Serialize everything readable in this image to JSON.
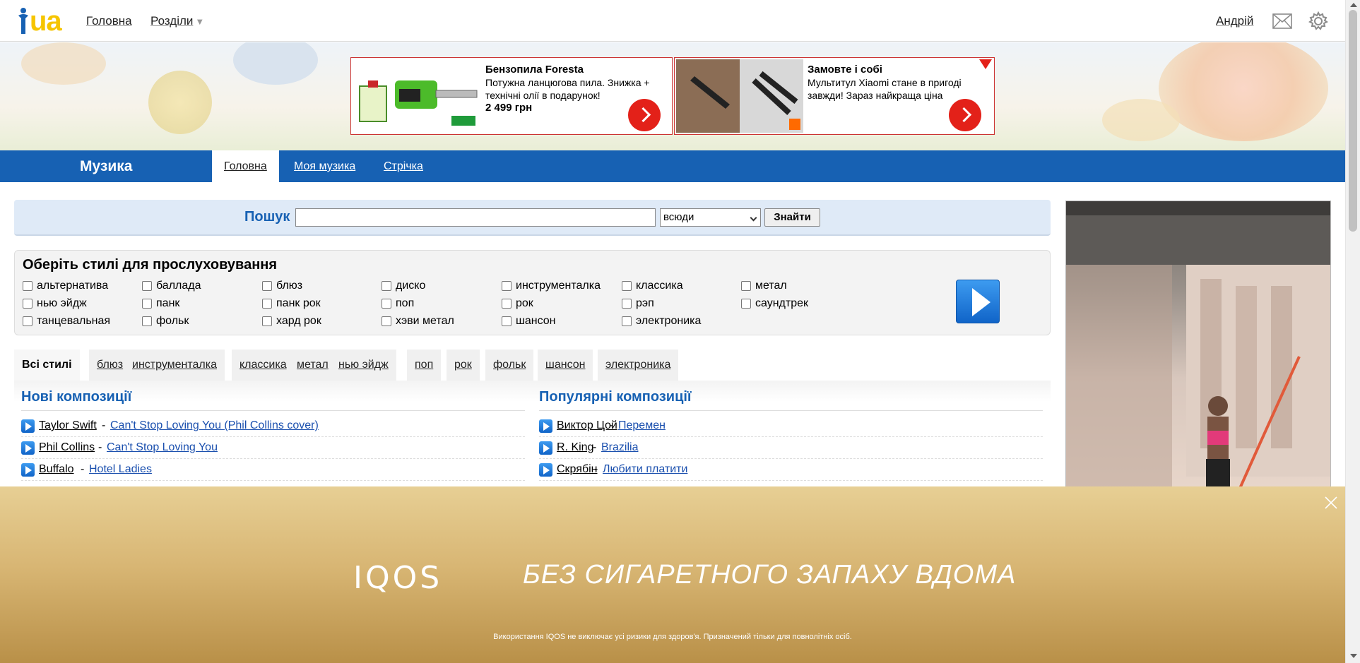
{
  "header": {
    "logo_text": "ua",
    "nav_home": "Головна",
    "nav_sections": "Розділи",
    "nav_sections_caret": "▼",
    "user_name": "Андрій"
  },
  "ads": [
    {
      "title": "Бензопила Foresta",
      "text": "Потужна ланцюгова пила. Знижка + технічні олії в подарунок!",
      "price": "2 499 грн"
    },
    {
      "title": "Замовте і собі",
      "text": "Мультитул Xiaomi стане в пригоді завжди! Зараз найкраща ціна",
      "price": ""
    }
  ],
  "music_bar": {
    "title": "Музика",
    "tabs": [
      "Головна",
      "Моя музика",
      "Стрічка"
    ]
  },
  "search": {
    "label": "Пошук",
    "value": "",
    "scope": "всюди",
    "button": "Знайти"
  },
  "styles": {
    "title": "Оберіть стилі для прослуховування",
    "items": [
      "альтернатива",
      "баллада",
      "блюз",
      "диско",
      "инструменталка",
      "классика",
      "метал",
      "нью эйдж",
      "панк",
      "панк рок",
      "поп",
      "рок",
      "рэп",
      "саундтрек",
      "танцевальная",
      "фольк",
      "хард рок",
      "хэви метал",
      "шансон",
      "электроника"
    ]
  },
  "genre_tabs": [
    "Всі стилі",
    "блюз",
    "инструменталка",
    "классика",
    "метал",
    "нью эйдж",
    "поп",
    "рок",
    "фольк",
    "шансон",
    "электроника"
  ],
  "new_tracks": {
    "heading": "Нові композиції",
    "rows": [
      {
        "artist": "Taylor Swift",
        "song": "Can't Stop Loving You (Phil Collins cover)"
      },
      {
        "artist": "Phil Collins",
        "song": "Can't Stop Loving You"
      },
      {
        "artist": "Buffalo",
        "song": "Hotel Ladies"
      }
    ]
  },
  "popular_tracks": {
    "heading": "Популярні композиції",
    "rows": [
      {
        "artist": "Виктор Цой",
        "song": "Перемен"
      },
      {
        "artist": "R. King",
        "song": "Brazilia"
      },
      {
        "artist": "Скрябін",
        "song": "Любити платити"
      }
    ]
  },
  "iqos": {
    "logo": "IQOS",
    "slogan": "БЕЗ СИГАРЕТНОГО ЗАПАХУ ВДОМА",
    "disclaimer": "Використання IQOS не виключає усі ризики для здоров'я. Призначений тільки для повнолітніх осіб."
  },
  "colors": {
    "brand_blue": "#1761b3",
    "link_blue": "#1a4fae",
    "ad_red": "#e32119",
    "logo_yellow": "#f6c500"
  }
}
